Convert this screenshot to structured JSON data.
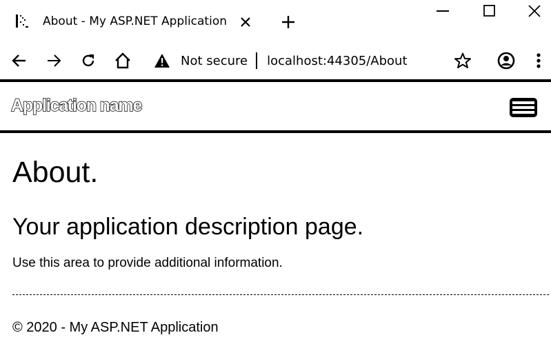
{
  "browser": {
    "tab": {
      "title": "About - My ASP.NET Application",
      "favicon": "loading-page-icon"
    },
    "window_controls": [
      "minimize",
      "maximize",
      "close"
    ],
    "toolbar": {
      "security_label": "Not secure",
      "url": "localhost:44305/About"
    }
  },
  "page": {
    "navbar": {
      "brand": "Application name"
    },
    "title": "About.",
    "subtitle": "Your application description page.",
    "text": "Use this area to provide additional information.",
    "footer": "© 2020 - My ASP.NET Application"
  }
}
